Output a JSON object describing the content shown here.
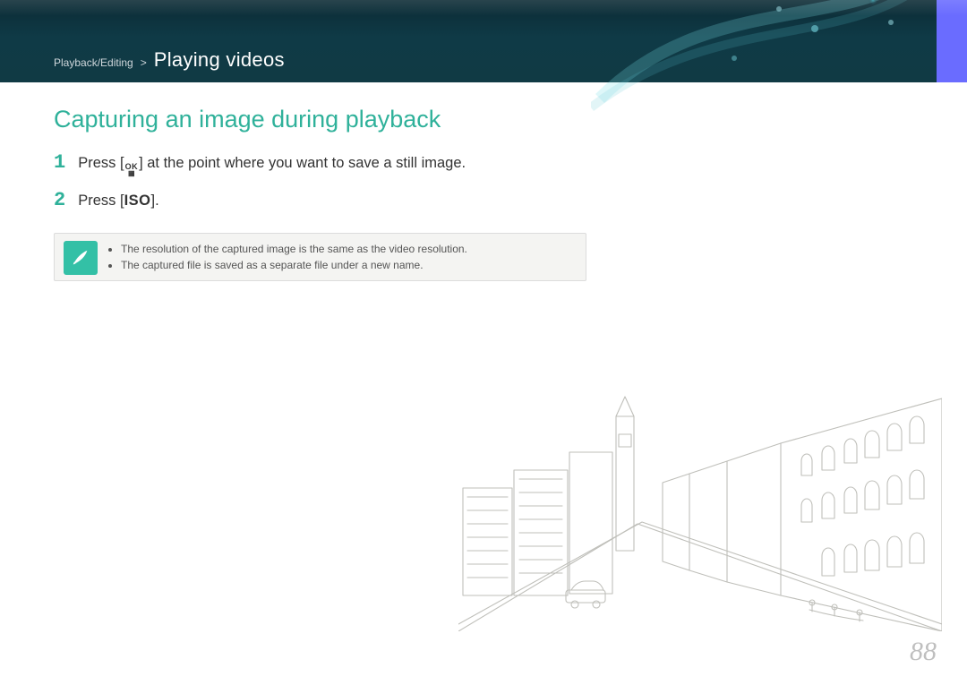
{
  "header": {
    "breadcrumb_section": "Playback/Editing",
    "breadcrumb_title": "Playing videos"
  },
  "page": {
    "title": "Capturing an image during playback",
    "page_number": "88"
  },
  "steps": [
    {
      "num": "1",
      "pre": "Press [",
      "icon_top": "OK",
      "icon_bot": "✔",
      "post": "] at the point where you want to save a still image."
    },
    {
      "num": "2",
      "pre": "Press [",
      "iso": "ISO",
      "post": "]."
    }
  ],
  "note": {
    "items": [
      "The resolution of the captured image is the same as the video resolution.",
      "The captured file is saved as a separate file under a new name."
    ]
  }
}
